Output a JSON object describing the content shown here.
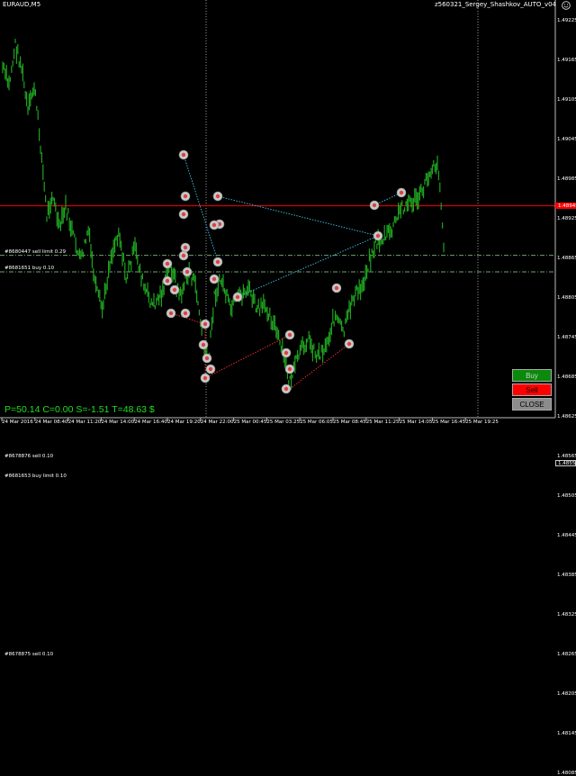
{
  "window": {
    "symbol_title": "EURAUD,M5",
    "expert_label": "z560321_Sergey_Shashkov_AUTO_v04",
    "expert_icon": "smiley-icon"
  },
  "colors": {
    "background": "#000000",
    "candles": "#1fa31f",
    "buy_line": "#6fa36f",
    "sell_line": "#ff0000",
    "grid": "#9a9a9a",
    "profit_text": "#22dd22"
  },
  "price_axis": {
    "ticks": [
      "1.49225",
      "1.49165",
      "1.49105",
      "1.49045",
      "1.48985",
      "1.48925",
      "1.48865",
      "1.48805",
      "1.48745",
      "1.48685",
      "1.48625",
      "1.48565",
      "1.48505",
      "1.48445",
      "1.48385",
      "1.48325",
      "1.48265",
      "1.48205",
      "1.48145",
      "1.48085"
    ],
    "price_markers": [
      {
        "text": "1.48945",
        "value": 1.48945,
        "color": "#ff0000"
      },
      {
        "text": "1.48555",
        "value": 1.48555,
        "color": "#000000"
      }
    ]
  },
  "time_axis": {
    "ticks": [
      "24 Mar 2016",
      "24 Mar 08:40",
      "24 Mar 11:20",
      "24 Mar 14:00",
      "24 Mar 16:40",
      "24 Mar 19:20",
      "24 Mar 22:00",
      "25 Mar 00:45",
      "25 Mar 03:25",
      "25 Mar 06:05",
      "25 Mar 08:45",
      "25 Mar 11:25",
      "25 Mar 14:05",
      "25 Mar 16:45",
      "25 Mar 19:25"
    ]
  },
  "orders": [
    {
      "label": "#8680447 sell limit 0.29",
      "price": 1.4887
    },
    {
      "label": "#8681651 buy 0.10",
      "price": 1.48845
    },
    {
      "label": "#8678876 sell 0.10",
      "price": 1.4856
    },
    {
      "label": "#8681653 buy limit 0.10",
      "price": 1.4853
    },
    {
      "label": "#8678875 sell 0.10",
      "price": 1.4826
    }
  ],
  "status": {
    "profit_line": "P=50.14  C=0.00  S=-1.51  T=48.63 $"
  },
  "buttons": {
    "buy": "Buy",
    "sell": "Sell",
    "close": "CLOSE"
  }
}
